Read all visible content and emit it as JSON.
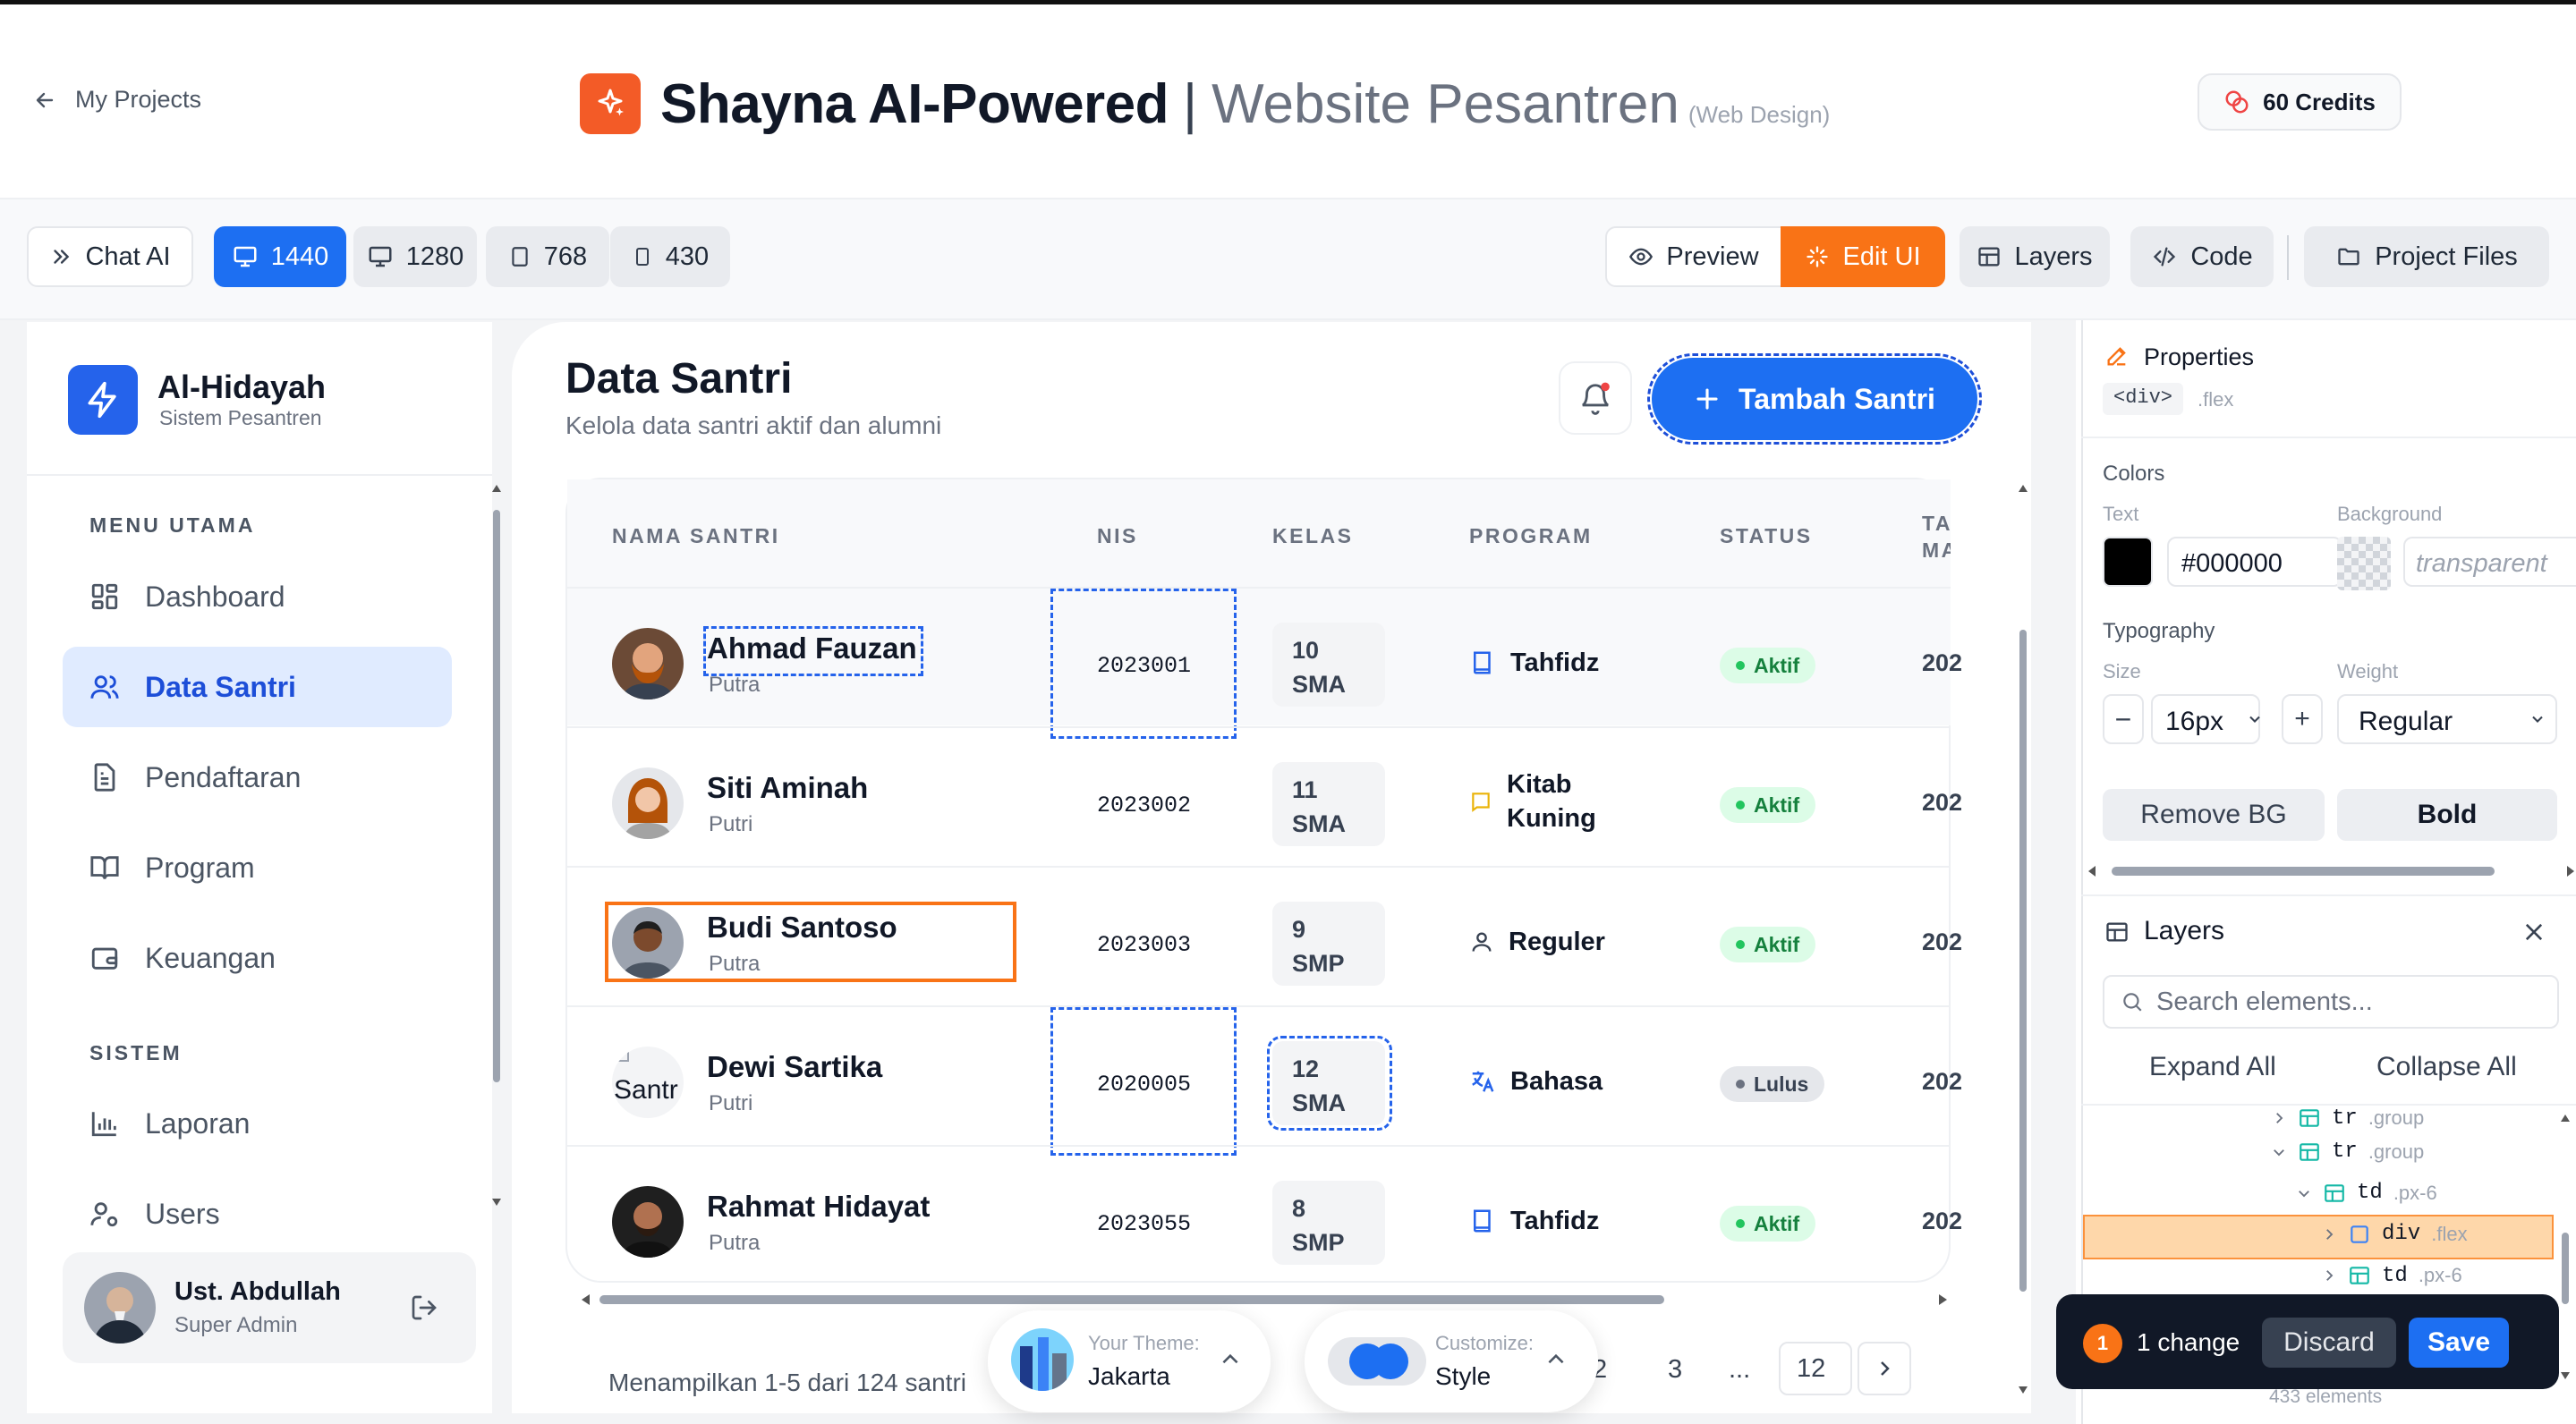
{
  "header": {
    "back_label": "My Projects",
    "title_main": "Shayna AI-Powered",
    "title_separator": "|",
    "title_sub": "Website Pesantren",
    "title_tag": "(Web Design)",
    "credits": "60 Credits"
  },
  "toolbar": {
    "chat_ai": "Chat AI",
    "widths": [
      "1440",
      "1280",
      "768",
      "430"
    ],
    "active_width": "1440",
    "preview": "Preview",
    "edit_ui": "Edit UI",
    "layers": "Layers",
    "code": "Code",
    "project_files": "Project Files"
  },
  "sidebar": {
    "brand_name": "Al-Hidayah",
    "brand_sub": "Sistem Pesantren",
    "section_main": "MENU UTAMA",
    "section_system": "SISTEM",
    "items": [
      {
        "label": "Dashboard",
        "icon": "grid-icon"
      },
      {
        "label": "Data Santri",
        "icon": "users-icon",
        "active": true
      },
      {
        "label": "Pendaftaran",
        "icon": "file-icon"
      },
      {
        "label": "Program",
        "icon": "book-open-icon"
      },
      {
        "label": "Keuangan",
        "icon": "wallet-icon"
      }
    ],
    "system_items": [
      {
        "label": "Laporan",
        "icon": "bar-chart-icon"
      },
      {
        "label": "Users",
        "icon": "user-cog-icon"
      }
    ],
    "user": {
      "name": "Ust. Abdullah",
      "role": "Super Admin"
    }
  },
  "main": {
    "title": "Data Santri",
    "subtitle": "Kelola data santri aktif dan alumni",
    "add_button": "Tambah Santri",
    "columns": [
      "NAMA SANTRI",
      "NIS",
      "KELAS",
      "PROGRAM",
      "STATUS",
      "TAH",
      "MAS"
    ],
    "rows": [
      {
        "name": "Ahmad Fauzan",
        "gender": "Putra",
        "nis": "2023001",
        "kelas_1": "10",
        "kelas_2": "SMA",
        "program_1": "Tahfidz",
        "program_2": "",
        "program_icon": "book-icon",
        "status": "Aktif",
        "year": "202"
      },
      {
        "name": "Siti Aminah",
        "gender": "Putri",
        "nis": "2023002",
        "kelas_1": "11",
        "kelas_2": "SMA",
        "program_1": "Kitab",
        "program_2": "Kuning",
        "program_icon": "book-marked-icon",
        "status": "Aktif",
        "year": "202"
      },
      {
        "name": "Budi Santoso",
        "gender": "Putra",
        "nis": "2023003",
        "kelas_1": "9",
        "kelas_2": "SMP",
        "program_1": "Reguler",
        "program_2": "",
        "program_icon": "user-icon",
        "status": "Aktif",
        "year": "202"
      },
      {
        "name": "Dewi Sartika",
        "gender": "Putri",
        "nis": "2020005",
        "kelas_1": "12",
        "kelas_2": "SMA",
        "program_1": "Bahasa",
        "program_2": "",
        "program_icon": "translate-icon",
        "status": "Lulus",
        "year": "202",
        "avatar_alt": "Santr"
      },
      {
        "name": "Rahmat Hidayat",
        "gender": "Putra",
        "nis": "2023055",
        "kelas_1": "8",
        "kelas_2": "SMP",
        "program_1": "Tahfidz",
        "program_2": "",
        "program_icon": "book-icon",
        "status": "Aktif",
        "year": "202"
      }
    ],
    "footer_text": "Menampilkan 1-5 dari 124 santri",
    "pages": [
      "2",
      "3",
      "...",
      "12"
    ]
  },
  "theme_pill": {
    "label": "Your Theme:",
    "value": "Jakarta"
  },
  "customize_pill": {
    "label": "Customize:",
    "value": "Style"
  },
  "properties": {
    "title": "Properties",
    "element_tag": "<div>",
    "element_class": ".flex",
    "colors_label": "Colors",
    "text_label": "Text",
    "background_label": "Background",
    "text_color": "#000000",
    "background_value": "transparent",
    "typography_label": "Typography",
    "size_label": "Size",
    "weight_label": "Weight",
    "size_value": "16px",
    "weight_value": "Regular",
    "remove_bg": "Remove BG",
    "bold": "Bold"
  },
  "layers_panel": {
    "title": "Layers",
    "search_placeholder": "Search elements...",
    "expand_all": "Expand All",
    "collapse_all": "Collapse All",
    "tree": [
      {
        "tag": "tr",
        "cls": ".group"
      },
      {
        "tag": "tr",
        "cls": ".group"
      },
      {
        "tag": "td",
        "cls": ".px-6"
      },
      {
        "tag": "div",
        "cls": ".flex",
        "selected": true
      },
      {
        "tag": "td",
        "cls": ".px-6"
      }
    ],
    "element_count": "433 elements"
  },
  "changes_bar": {
    "count": "1",
    "label": "1 change",
    "discard": "Discard",
    "save": "Save"
  },
  "colors": {
    "accent_blue": "#1d6ff2",
    "accent_orange": "#f97316",
    "success": "#15803d"
  }
}
